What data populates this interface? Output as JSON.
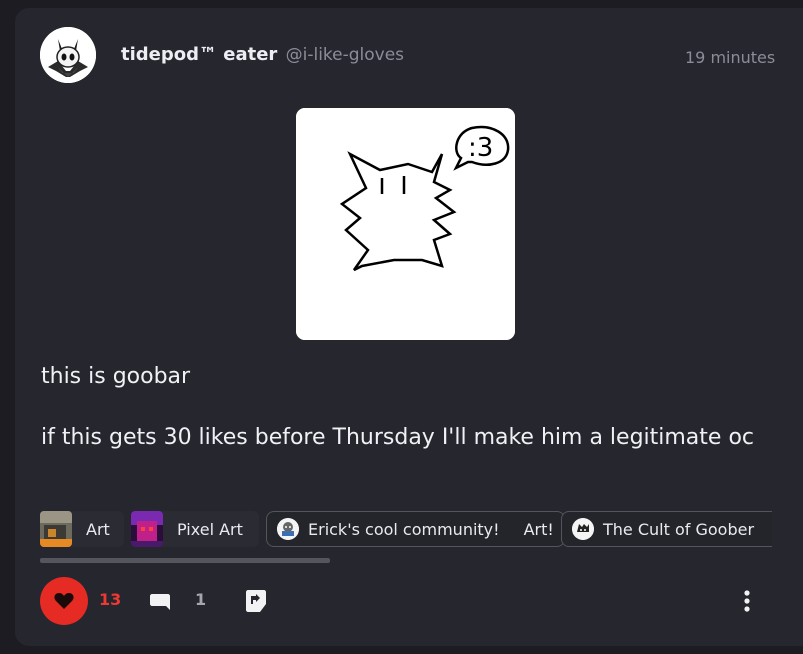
{
  "post": {
    "author": {
      "display_name": "tidepod™ eater",
      "handle": "@i-like-gloves",
      "avatar_icon": "hollow-knight-avatar"
    },
    "timestamp": "19 minutes",
    "image": {
      "icon": "goobar-drawing",
      "speech_text": ":3"
    },
    "paragraphs": [
      "this is goobar",
      "if this gets 30 likes before Thursday I'll make him a legitimate oc"
    ],
    "tags": [
      {
        "label": "Art",
        "thumb_icon": "art-thumbnail"
      },
      {
        "label": "Pixel Art",
        "thumb_icon": "pixel-art-thumbnail"
      }
    ],
    "communities": [
      {
        "name": "Erick's cool community!",
        "sub_label": "Art!",
        "icon": "community-icon"
      },
      {
        "name": "The Cult of Goober",
        "icon": "community-icon"
      }
    ],
    "actions": {
      "like_count": "13",
      "comment_count": "1",
      "like_icon": "heart-icon",
      "comment_icon": "comment-icon",
      "reblog_icon": "reblog-icon",
      "more_icon": "more-vertical-icon"
    }
  },
  "colors": {
    "background": "#1c1c22",
    "card": "#26262e",
    "like_red": "#e52b24",
    "muted_text": "#8c8c99"
  }
}
